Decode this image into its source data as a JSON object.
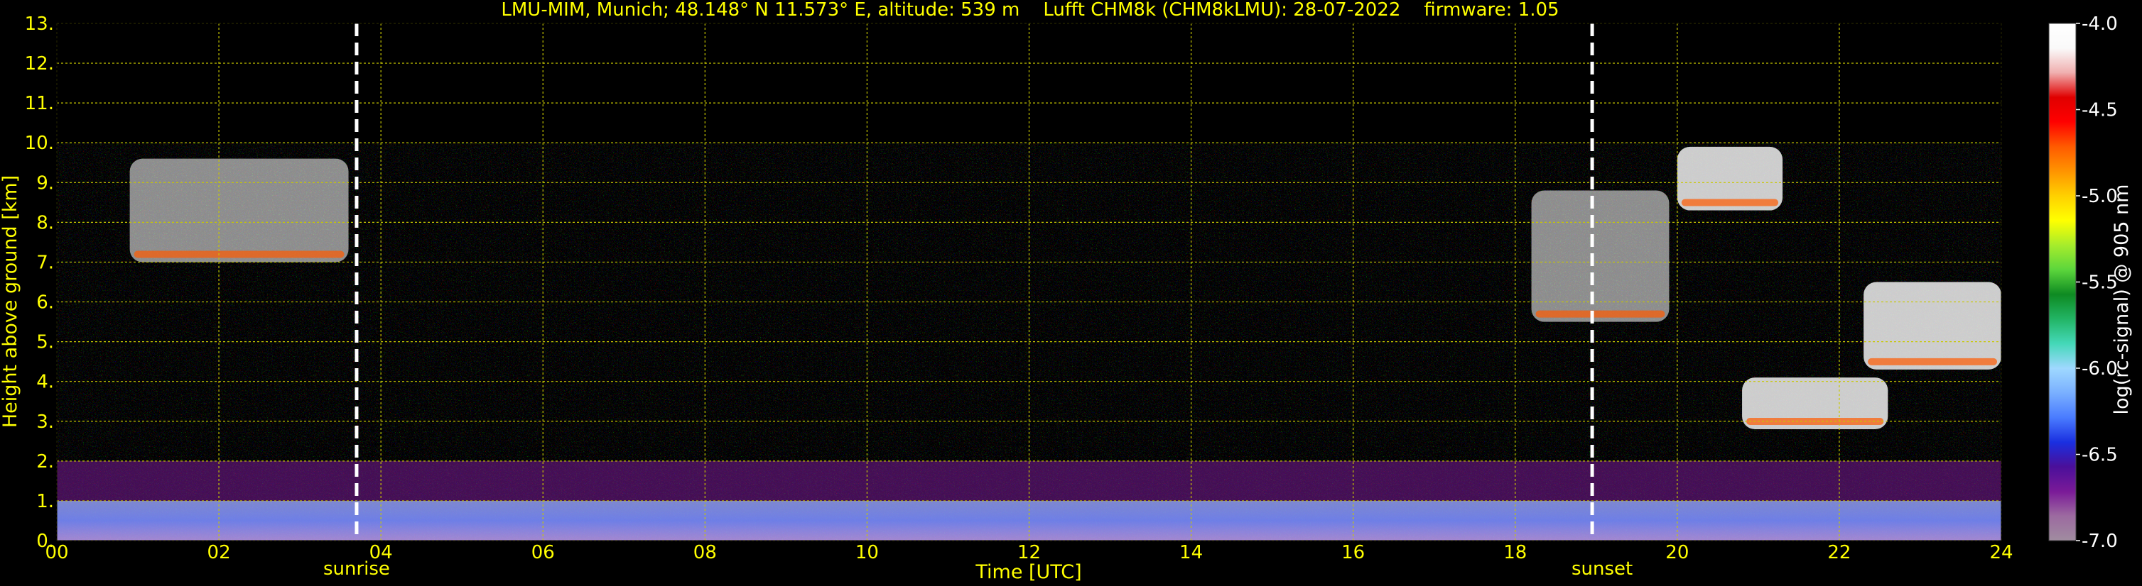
{
  "chart_data": {
    "type": "heatmap",
    "title": "LMU-MIM, Munich; 48.148° N 11.573° E, altitude: 539 m    Lufft CHM8k (CHM8kLMU): 28-07-2022    firmware: 1.05",
    "xlabel": "Time [UTC]",
    "ylabel": "Height above ground [km]",
    "xlim": [
      0,
      24
    ],
    "ylim": [
      0,
      13
    ],
    "data_ceiling_km": 10,
    "x_tick_labels": [
      "00",
      "02",
      "04",
      "06",
      "08",
      "10",
      "12",
      "14",
      "16",
      "18",
      "20",
      "22",
      "24"
    ],
    "y_tick_labels": [
      "0.",
      "1.",
      "2.",
      "3.",
      "4.",
      "5.",
      "6.",
      "7.",
      "8.",
      "9.",
      "10.",
      "11.",
      "12.",
      "13."
    ],
    "grid": true,
    "sunrise_utc": 3.7,
    "sunset_utc": 18.95,
    "sunrise_label": "sunrise",
    "sunset_label": "sunset",
    "colorbar": {
      "label": "log(rc-signal) @ 905 nm",
      "min": -7.0,
      "max": -4.0,
      "tick_labels": [
        "-7.0",
        "-6.5",
        "-6.0",
        "-5.5",
        "-5.0",
        "-4.5",
        "-4.0"
      ]
    },
    "features": [
      {
        "kind": "aerosol-layer",
        "t_start": 0,
        "t_end": 24,
        "z_low_km": 0,
        "z_high_km": 1.0
      },
      {
        "kind": "residual-layer",
        "t_start": 0,
        "t_end": 24,
        "z_low_km": 1.0,
        "z_high_km": 2.0
      },
      {
        "kind": "cirrus",
        "t_start": 0.9,
        "t_end": 3.6,
        "z_low_km": 7.0,
        "z_high_km": 9.6
      },
      {
        "kind": "cirrus",
        "t_start": 18.2,
        "t_end": 19.9,
        "z_low_km": 5.5,
        "z_high_km": 8.8
      },
      {
        "kind": "cloud",
        "t_start": 20.0,
        "t_end": 21.3,
        "z_low_km": 8.3,
        "z_high_km": 9.9
      },
      {
        "kind": "cloud",
        "t_start": 22.3,
        "t_end": 24,
        "z_low_km": 4.3,
        "z_high_km": 6.5
      },
      {
        "kind": "cloud",
        "t_start": 20.8,
        "t_end": 22.6,
        "z_low_km": 2.8,
        "z_high_km": 4.1
      }
    ]
  },
  "colors": {
    "axis_text": "#ffff00",
    "grid": "#c8c800",
    "background": "#000000",
    "colormap": [
      "#a08ca0",
      "#9c6aa0",
      "#7a1a98",
      "#4a0f9a",
      "#1a2fe0",
      "#4a7cff",
      "#7ab0ff",
      "#9fd8ff",
      "#44d8b8",
      "#22b464",
      "#0e8a22",
      "#5cd63c",
      "#a6ec2c",
      "#ffff00",
      "#ffd000",
      "#ff9400",
      "#ff5a00",
      "#ff0000",
      "#e00000",
      "#f0b0b0",
      "#fafafa",
      "#ffffff"
    ]
  }
}
